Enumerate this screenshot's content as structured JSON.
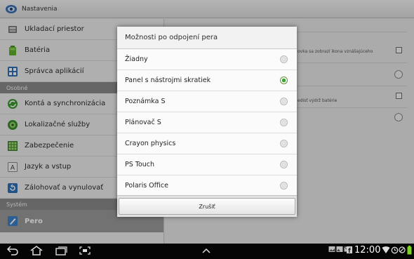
{
  "app": {
    "title": "Nastavenia",
    "icon": "settings-icon"
  },
  "sidebar": {
    "items_top": [
      {
        "label": "Ukladací priestor",
        "icon": "storage-icon"
      },
      {
        "label": "Batéria",
        "icon": "battery-icon"
      },
      {
        "label": "Správca aplikácií",
        "icon": "app-manager-icon"
      }
    ],
    "section_personal": "Osobné",
    "items_personal": [
      {
        "label": "Kontá a synchronizácia",
        "icon": "sync-icon"
      },
      {
        "label": "Lokalizačné služby",
        "icon": "location-icon"
      },
      {
        "label": "Zabezpečenie",
        "icon": "security-icon"
      },
      {
        "label": "Jazyk a vstup",
        "icon": "language-icon"
      },
      {
        "label": "Zálohovať a vynulovať",
        "icon": "backup-icon"
      }
    ],
    "section_system": "Systém",
    "items_system": [
      {
        "label": "Pero",
        "icon": "pen-icon",
        "selected": true
      }
    ]
  },
  "right_pane": {
    "row1_text": "ovka sa zobrazí ikona vznášajúceho",
    "row3_text": "edisť výdrž batérie"
  },
  "dialog": {
    "title": "Možnosti po odpojení pera",
    "options": [
      {
        "label": "Žiadny",
        "selected": false
      },
      {
        "label": "Panel s nástrojmi skratiek",
        "selected": true
      },
      {
        "label": "Poznámka S",
        "selected": false
      },
      {
        "label": "Plánovač S",
        "selected": false
      },
      {
        "label": "Crayon physics",
        "selected": false
      },
      {
        "label": "PS Touch",
        "selected": false
      },
      {
        "label": "Polaris Office",
        "selected": false
      }
    ],
    "cancel_label": "Zrušiť"
  },
  "system_bar": {
    "clock": "12:00",
    "nav_icons": [
      "back-icon",
      "home-icon",
      "recent-apps-icon",
      "screenshot-icon",
      "up-arrow-icon"
    ],
    "status_icons": [
      "image-icon",
      "gallery-icon",
      "message-icon",
      "facebook-icon",
      "wifi-icon",
      "alarm-icon",
      "battery-status-icon"
    ]
  },
  "colors": {
    "accent_green": "#3aa53a",
    "section_header": "#8a8a8a",
    "system_bar": "#050505"
  }
}
